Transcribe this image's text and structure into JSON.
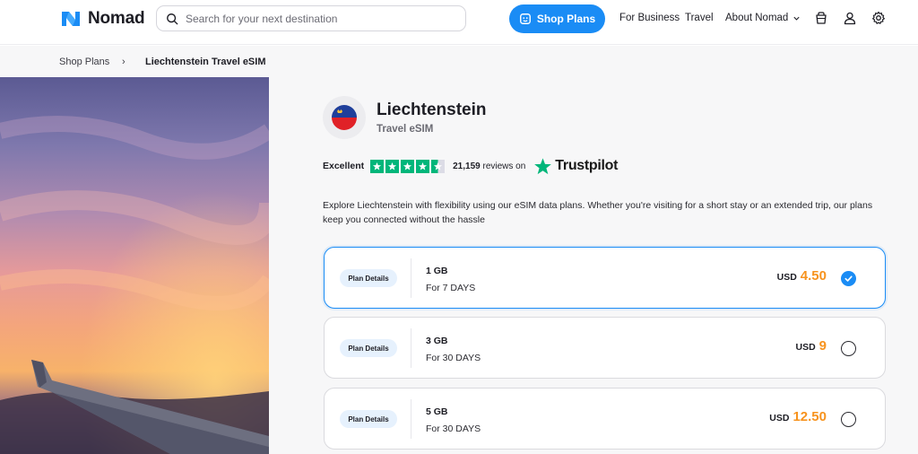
{
  "header": {
    "logo_text": "Nomad",
    "search_placeholder": "Search for your next destination",
    "shop_plans_label": "Shop Plans",
    "nav": {
      "for_business": "For Business",
      "travel": "Travel",
      "about": "About Nomad"
    },
    "icons": [
      "chevron-down-icon",
      "cart-icon",
      "user-icon",
      "gear-icon"
    ]
  },
  "breadcrumb": {
    "parent": "Shop Plans",
    "separator": "›",
    "current": "Liechtenstein Travel eSIM"
  },
  "destination": {
    "country": "Liechtenstein",
    "subtitle": "Travel eSIM"
  },
  "rating": {
    "label": "Excellent",
    "stars": 4.5,
    "review_count": "21,159",
    "reviews_suffix": "reviews on",
    "provider": "Trustpilot"
  },
  "description": "Explore Liechtenstein with flexibility using our eSIM data plans. Whether you're visiting for a short stay or an extended trip, our plans keep you connected without the hassle",
  "plans": [
    {
      "details_label": "Plan Details",
      "data": "1 GB",
      "duration": "For 7 DAYS",
      "currency": "USD",
      "price": "4.50",
      "selected": true
    },
    {
      "details_label": "Plan Details",
      "data": "3 GB",
      "duration": "For 30 DAYS",
      "currency": "USD",
      "price": "9",
      "selected": false
    },
    {
      "details_label": "Plan Details",
      "data": "5 GB",
      "duration": "For 30 DAYS",
      "currency": "USD",
      "price": "12.50",
      "selected": false
    }
  ],
  "colors": {
    "accent": "#1a8cf5",
    "price": "#f7931e",
    "trustpilot_green": "#00b67a"
  }
}
